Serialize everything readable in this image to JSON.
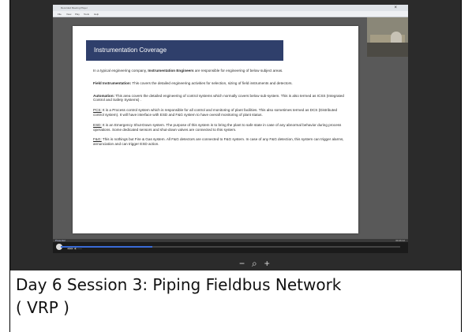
{
  "window": {
    "app_title": "Recorded Meeting Player",
    "menu": [
      "File",
      "View",
      "Play",
      "Tools",
      "Help"
    ],
    "close_glyph": "×"
  },
  "slide": {
    "title": "Instrumentation Coverage",
    "intro_prefix": "In a typical engineering company, ",
    "intro_bold": "Instrumentation Engineers",
    "intro_suffix": " are responsible for engineering of below subject areas.",
    "field_label": "Field Instrumentation:",
    "field_text": " This covers the detailed engineering activities for selection, sizing of field instruments and detectors.",
    "automation_label": "Automation:",
    "automation_text": " This area covers the detailed engineering of control systems which normally covers below sub-system. This is also termed as ICSS (Integrated Control and Safety Systems) .",
    "pcs_label": "PCS:",
    "pcs_text": " It is a Process control system which is responsible for all control and monitoring of plant facilities. This also sometimes termed as DCS (Distributed control system). It will have interface with ESD and F&G system to have overall monitoring of plant status.",
    "esd_label": "ESD:",
    "esd_text": " It is an Emergency Shut-Down system. The purpose of this system is to bring the plant to safe state in case of any abnormal behavior during process operations. Some dedicated sensors and shut-down valves are connected to this system.",
    "fg_label": "F&G:",
    "fg_text": " This is nothings but Fire & Gas system. All F&G detectors are connected to F&G system. In case of any F&G detection, this system can trigger alarms, annunciation and can trigger ESD action."
  },
  "player": {
    "rec_label": "Presenter",
    "time_right": "00:46:12",
    "controls_text": "◀ ▶▶  ◀)  ——",
    "progress_fraction": 0.27
  },
  "zoom": {
    "minus": "−",
    "search": "⌕",
    "plus": "+"
  },
  "caption": {
    "line1": "Day 6 Session 3:  Piping Fieldbus Network",
    "line2": "( VRP )"
  }
}
